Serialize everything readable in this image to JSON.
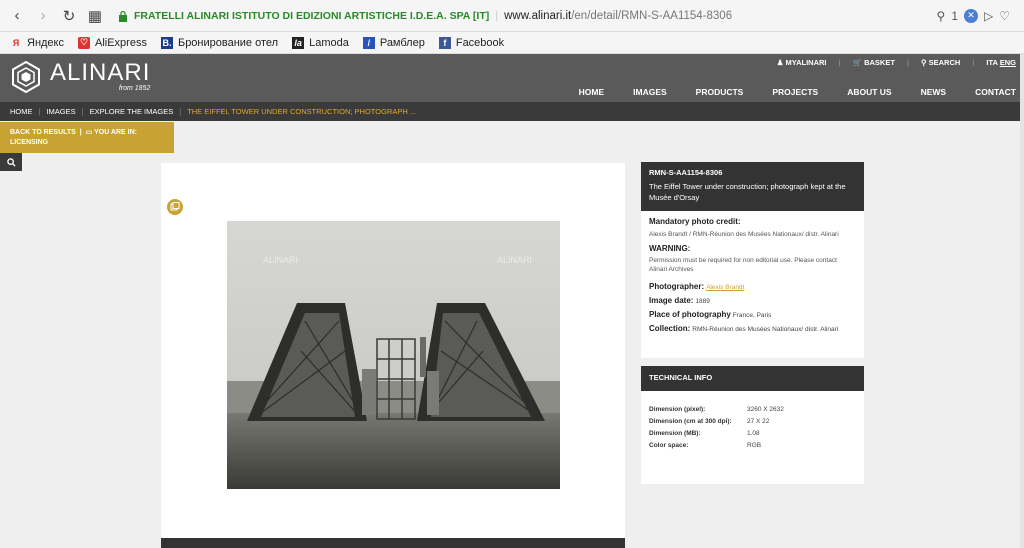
{
  "browser": {
    "site_name": "FRATELLI ALINARI ISTITUTO DI EDIZIONI ARTISTICHE I.D.E.A. SPA [IT]",
    "url_domain": "www.alinari.it",
    "url_path": "/en/detail/RMN-S-AA1154-8306",
    "ext_count": "1"
  },
  "bookmarks": [
    {
      "label": "Яндекс",
      "icon": "yandex-icon",
      "color": "#e03030"
    },
    {
      "label": "AliExpress",
      "icon": "aliexpress-icon",
      "color": "#e03030"
    },
    {
      "label": "Бронирование отел",
      "icon": "booking-icon",
      "color": "#1c3e8a"
    },
    {
      "label": "Lamoda",
      "icon": "lamoda-icon",
      "color": "#222222"
    },
    {
      "label": "Рамблер",
      "icon": "rambler-icon",
      "color": "#2a52be"
    },
    {
      "label": "Facebook",
      "icon": "facebook-icon",
      "color": "#3b5998"
    }
  ],
  "header": {
    "logo_text": "ALINARI",
    "logo_sub": "from 1852",
    "util": {
      "myalinari": "MYALINARI",
      "basket": "BASKET",
      "search": "SEARCH",
      "lang_ita": "ITA",
      "lang_eng": "ENG"
    },
    "nav": [
      "HOME",
      "IMAGES",
      "PRODUCTS",
      "PROJECTS",
      "ABOUT US",
      "NEWS",
      "CONTACT"
    ]
  },
  "breadcrumb": [
    "HOME",
    "IMAGES",
    "EXPLORE THE IMAGES"
  ],
  "breadcrumb_current": "THE EIFFEL TOWER UNDER CONSTRUCTION; PHOTOGRAPH ...",
  "panel": {
    "back": "BACK TO RESULTS",
    "you_are_in": "YOU ARE IN:",
    "section": "LICENSING"
  },
  "watermark": "ALINARI",
  "info": {
    "code": "RMN-S-AA1154-8306",
    "title": "The Eiffel Tower under construction; photograph kept at the Musée d'Orsay",
    "credit_label": "Mandatory photo credit:",
    "credit_value": "Alexis Brandt / RMN-Réunion des Musées Nationaux/ distr. Alinari",
    "warning_label": "WARNING:",
    "warning_value": "Permission must be required for non editorial use. Please contact Alinari Archives",
    "photographer_label": "Photographer:",
    "photographer_value": "Alexis Brandt",
    "date_label": "Image date:",
    "date_value": "1889",
    "place_label": "Place of photography",
    "place_value": "France, Paris",
    "collection_label": "Collection:",
    "collection_value": "RMN-Réunion des Musées Nationaux/ distr. Alinari"
  },
  "tech": {
    "title": "TECHNICAL INFO",
    "rows": [
      {
        "k": "Dimension (pixel):",
        "v": "3260 X 2632"
      },
      {
        "k": "Dimension (cm at 300 dpi):",
        "v": "27 X 22"
      },
      {
        "k": "Dimension (MB):",
        "v": "1.08"
      },
      {
        "k": "Color space:",
        "v": "RGB"
      }
    ]
  }
}
